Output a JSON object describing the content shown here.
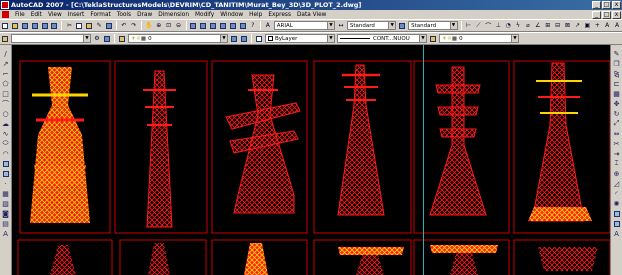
{
  "window": {
    "title": "AutoCAD 2007 - [C:\\TeklaStructuresModels\\DEVRIM\\CD_TANITIM\\Murat_Bey_3D\\3D_PLOT_2.dwg]",
    "minimize": "_",
    "maximize": "□",
    "close": "x"
  },
  "menu": {
    "items": [
      "File",
      "Edit",
      "View",
      "Insert",
      "Format",
      "Tools",
      "Draw",
      "Dimension",
      "Modify",
      "Window",
      "Help",
      "Express",
      "Data View"
    ]
  },
  "toolbar1": {
    "text_style": "ARIAL",
    "dim_style": "Standard",
    "table_style": "Standard"
  },
  "toolbar2": {
    "layer_value": "0",
    "layer_value_2": "0",
    "color": "ByLayer",
    "linetype": "CONT...NUOU",
    "plot_layer": "0"
  },
  "colors": {
    "model": "#ff1a1a",
    "highlight": "#ffd400",
    "frame": "#cc0000",
    "crosshair": "#2bb3b3"
  }
}
